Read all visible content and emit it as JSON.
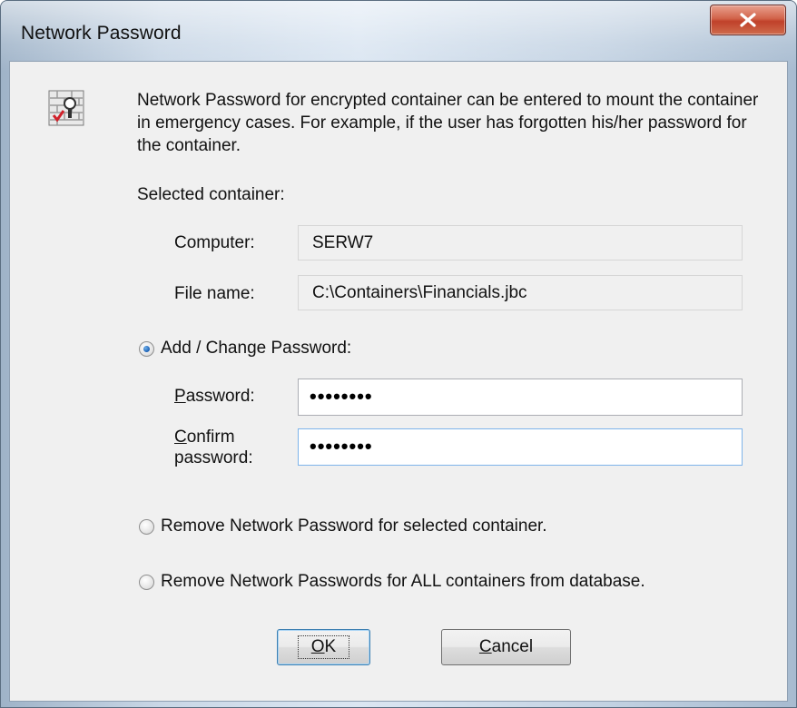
{
  "window": {
    "title": "Network Password",
    "close_icon": "close-x-icon"
  },
  "header": {
    "icon": "container-lock-icon",
    "description": "Network Password for encrypted container can be entered to mount the container in emergency cases. For example, if the user has forgotten his/her password for the container."
  },
  "selected_container": {
    "label": "Selected container:",
    "computer_label": "Computer:",
    "computer_value": "SERW7",
    "file_label": "File name:",
    "file_value": "C:\\Containers\\Financials.jbc"
  },
  "options": {
    "add_change": {
      "label": "Add / Change Password:",
      "checked": true
    },
    "remove_selected": {
      "label": "Remove Network Password for selected container.",
      "checked": false
    },
    "remove_all": {
      "label": "Remove Network Passwords for ALL containers from database.",
      "checked": false
    }
  },
  "password": {
    "label_mnemonic": "P",
    "label_rest": "assword:",
    "value": "••••••••"
  },
  "confirm": {
    "label_mnemonic": "C",
    "label_line1_rest": "onfirm",
    "label_line2": "password:",
    "value": "••••••••"
  },
  "buttons": {
    "ok_mnemonic": "O",
    "ok_rest": "K",
    "cancel_mnemonic": "C",
    "cancel_rest": "ancel"
  },
  "colors": {
    "close_button": "#c9472f",
    "radio_selected": "#1a5fb4",
    "focus_border": "#7eb4ea"
  }
}
